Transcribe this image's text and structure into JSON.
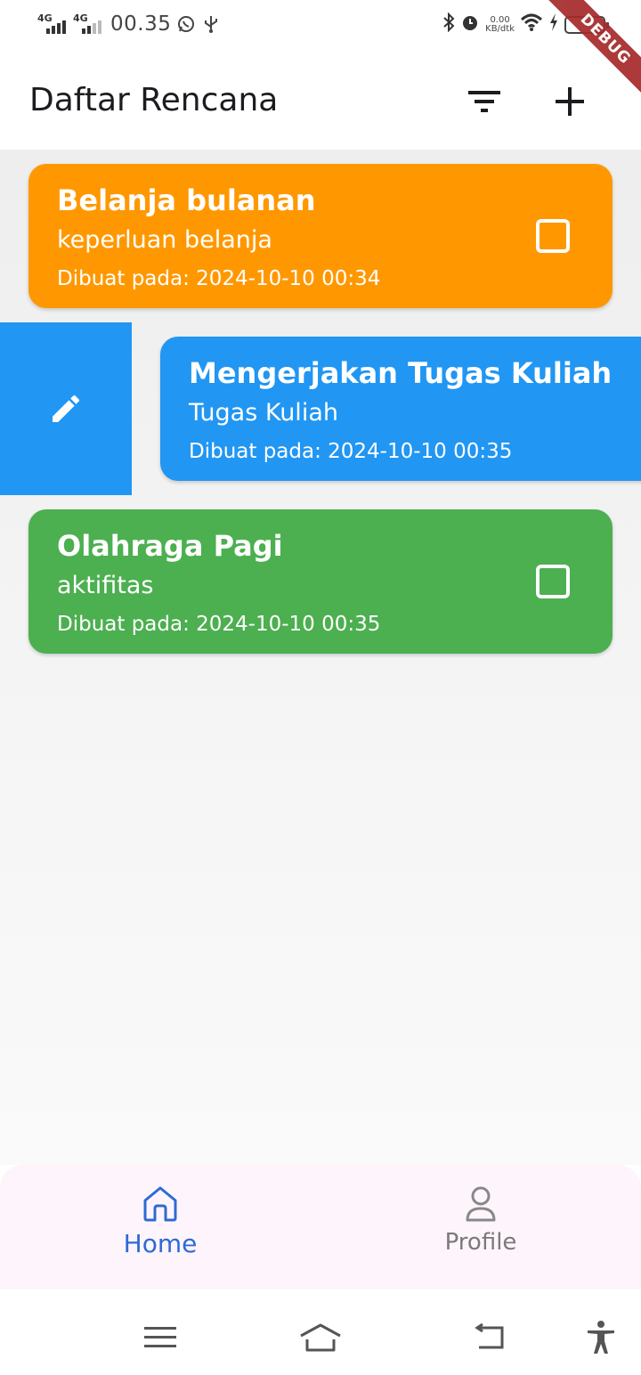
{
  "status_bar": {
    "network_1": "4G",
    "network_2": "4G",
    "time": "00.35",
    "speed_value": "0.00",
    "speed_unit": "KB/dtk"
  },
  "debug_banner": "DEBUG",
  "app_bar": {
    "title": "Daftar Rencana",
    "filter_icon": "filter-icon",
    "add_icon": "add-icon"
  },
  "plans": [
    {
      "title": "Belanja bulanan",
      "description": "keperluan belanja",
      "created": "Dibuat pada: 2024-10-10 00:34",
      "color": "#ff9800",
      "checked": false
    },
    {
      "title": "Mengerjakan Tugas Kuliah",
      "description": "Tugas Kuliah",
      "created": "Dibuat pada: 2024-10-10 00:35",
      "color": "#2196f3",
      "swiped": true,
      "swipe_action_icon": "edit-icon"
    },
    {
      "title": "Olahraga Pagi",
      "description": "aktifitas",
      "created": "Dibuat pada: 2024-10-10 00:35",
      "color": "#4caf50",
      "checked": false
    }
  ],
  "bottom_nav": {
    "items": [
      {
        "label": "Home",
        "icon": "home-icon",
        "active": true,
        "color": "#2e6ad6"
      },
      {
        "label": "Profile",
        "icon": "person-icon",
        "active": false,
        "color": "#7a7a7a"
      }
    ]
  }
}
